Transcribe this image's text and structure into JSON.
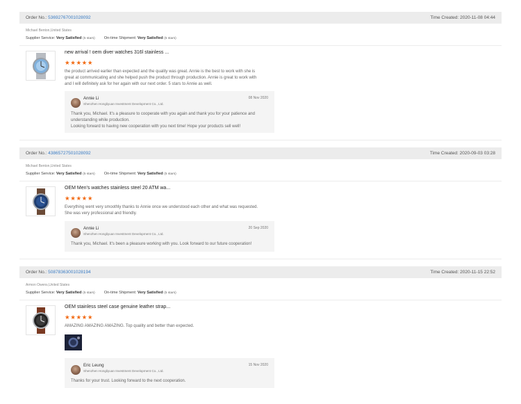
{
  "labels": {
    "order_no": "Order No.:",
    "time_created": "Time Created:",
    "supplier_service": "Supplier Service:",
    "ontime_shipment": "On-time Shipment:",
    "star_glyphs": "★★★★★"
  },
  "reviews": [
    {
      "order_no": "53692767001028092",
      "time_created": "2020-11-08 04:44",
      "buyer": "Michael Benton,United States",
      "supplier_service": "Very Satisfied",
      "supplier_stars": "(5 stars)",
      "shipment": "Very Satisfied",
      "shipment_stars": "(5 stars)",
      "product_title": "new arrival ! oem diver watches 316l stainless ...",
      "rating": 5,
      "text": "the product arrived earlier than expected and the quality was great.  Annie is the best to work with she is great at communicating and she helped push the product through production.  Annie is great to work with and I will definitely ask for her again with our next order. 5 stars to Annie as well.",
      "reply": {
        "name": "Annie Li",
        "company": "Shenzhen Hongliyuan Investment Development Co., Ltd.",
        "date": "08 Nov 2020",
        "text": "Thank you, Michael. It's a pleasure to cooperate with you again and thank you for your patience and understanding while production.\nLooking forward to having new cooperation with you next time! Hope your products sell well!"
      }
    },
    {
      "order_no": "43865727501028092",
      "time_created": "2020-09-03 03:28",
      "buyer": "Michael Benton,United States",
      "supplier_service": "Very Satisfied",
      "supplier_stars": "(5 stars)",
      "shipment": "Very Satisfied",
      "shipment_stars": "(5 stars)",
      "product_title": "OEM Men's watches stainless steel 20 ATM wa...",
      "rating": 5,
      "text": "Everything went very smoothly thanks to Annie once we understood each other and what was requested.  She was very professional and friendly.",
      "reply": {
        "name": "Annie Li",
        "company": "Shenzhen Hongliyuan Investment Development Co., Ltd.",
        "date": "20 Sep 2020",
        "text": "Thank you, Michael. It's been a pleasure working with you. Look forward to our future cooperation!"
      }
    },
    {
      "order_no": "50878363001028194",
      "time_created": "2020-11-15 22:52",
      "buyer": "Armon Owens,United States",
      "supplier_service": "Very Satisfied",
      "supplier_stars": "(5 stars)",
      "shipment": "Very Satisfied",
      "shipment_stars": "(5 stars)",
      "product_title": "OEM stainless steel case genuine leather strap...",
      "rating": 5,
      "text": "AMAZING AMAZING AMAZING. Top quality and better than expected.",
      "reply": {
        "name": "Eric Leung",
        "company": "Shenzhen Hongliyuan Investment Development Co., Ltd.",
        "date": "15 Nov 2020",
        "text": "Thanks for your trust. Looking forward to the next cooperation."
      }
    }
  ],
  "colors": {
    "link": "#3a7cc4",
    "star": "#f26a12",
    "order_bar": "#ececec",
    "reply_bg": "#f4f4f4"
  }
}
